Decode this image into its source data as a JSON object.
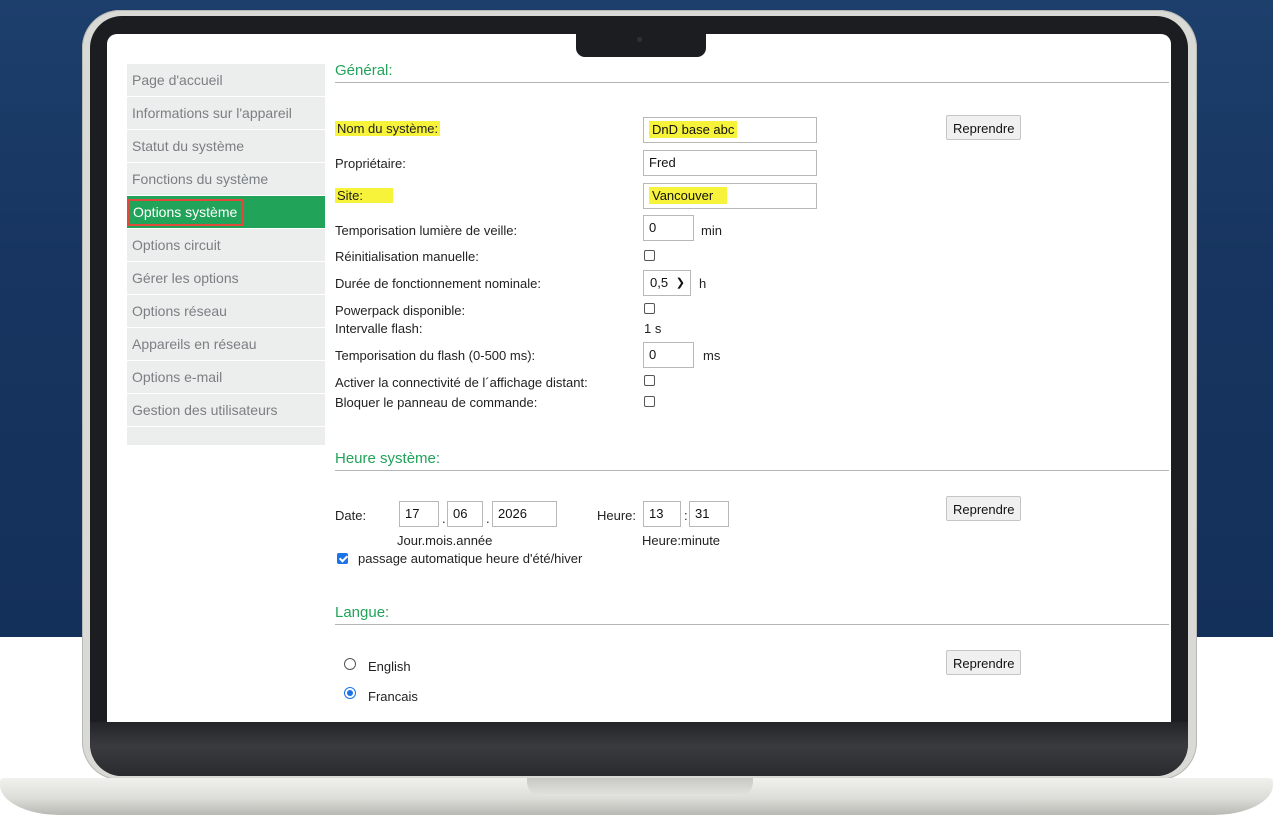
{
  "sidebar": {
    "items": [
      {
        "label": "Page d'accueil"
      },
      {
        "label": "Informations sur l'appareil"
      },
      {
        "label": "Statut du système"
      },
      {
        "label": "Fonctions du système"
      },
      {
        "label": "Options système",
        "active": true
      },
      {
        "label": "Options circuit"
      },
      {
        "label": "Gérer les options"
      },
      {
        "label": "Options réseau"
      },
      {
        "label": "Appareils en réseau"
      },
      {
        "label": "Options e-mail"
      },
      {
        "label": "Gestion des utilisateurs"
      }
    ]
  },
  "general": {
    "title": "Général:",
    "reprendre": "Reprendre",
    "system_name_label": "Nom du système:",
    "system_name_value": "DnD base abc",
    "owner_label": "Propriétaire:",
    "owner_value": "Fred",
    "site_label": "Site:",
    "site_value": "Vancouver",
    "standby_label": "Temporisation lumière de veille:",
    "standby_value": "0",
    "standby_unit": "min",
    "manual_reset_label": "Réinitialisation manuelle:",
    "manual_reset_checked": false,
    "duration_label": "Durée de fonctionnement nominale:",
    "duration_value": "0,5",
    "duration_unit": "h",
    "powerpack_label": "Powerpack disponible:",
    "powerpack_checked": false,
    "flash_interval_label": "Intervalle flash:",
    "flash_interval_value": "1 s",
    "flash_delay_label": "Temporisation du flash (0-500 ms):",
    "flash_delay_value": "0",
    "flash_delay_unit": "ms",
    "remote_display_label": "Activer la connectivité de l´affichage distant:",
    "remote_display_checked": false,
    "lock_panel_label": "Bloquer le panneau de commande:",
    "lock_panel_checked": false
  },
  "system_time": {
    "title": "Heure système:",
    "reprendre": "Reprendre",
    "date_label": "Date:",
    "day": "17",
    "month": "06",
    "year": "2026",
    "date_sep": ".",
    "date_hint": "Jour.mois.année",
    "time_label": "Heure:",
    "hour": "13",
    "minute": "31",
    "time_sep": ":",
    "time_hint": "Heure:minute",
    "dst_label": "passage automatique heure d'été/hiver",
    "dst_checked": true
  },
  "language": {
    "title": "Langue:",
    "reprendre": "Reprendre",
    "options": [
      {
        "label": "English",
        "selected": false
      },
      {
        "label": "Francais",
        "selected": true
      }
    ]
  },
  "colors": {
    "accent_green": "#21a35a",
    "highlight_yellow": "#f7f23a",
    "background_navy": "#173560",
    "active_outline": "#e04a3a"
  }
}
